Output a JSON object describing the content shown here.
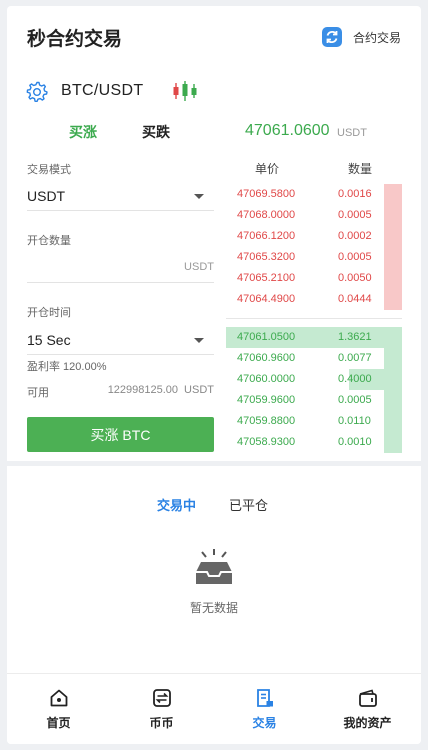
{
  "header": {
    "title": "秒合约交易",
    "contract_link_label": "合约交易",
    "contract_icon": "swap-icon"
  },
  "pair": {
    "settings_icon": "gear-icon",
    "name": "BTC/USDT",
    "chart_icon": "candlestick-icon"
  },
  "side_tabs": {
    "buy_label": "买涨",
    "sell_label": "买跌",
    "selected": "buy"
  },
  "last_price": {
    "value": "47061.0600",
    "unit": "USDT"
  },
  "form": {
    "mode_label": "交易模式",
    "mode_value": "USDT",
    "qty_label": "开仓数量",
    "qty_value": "",
    "qty_unit": "USDT",
    "time_label": "开仓时间",
    "time_value": "15 Sec",
    "profit_rate": "盈利率 120.00%",
    "available_label": "可用",
    "available_value": "122998125.00",
    "available_unit": "USDT",
    "submit_label": "买涨 BTC"
  },
  "orderbook": {
    "price_header": "单价",
    "qty_header": "数量",
    "asks": [
      {
        "price": "47069.5800",
        "qty": "0.0016",
        "depth": 0.1
      },
      {
        "price": "47068.0000",
        "qty": "0.0005",
        "depth": 0.1
      },
      {
        "price": "47066.1200",
        "qty": "0.0002",
        "depth": 0.1
      },
      {
        "price": "47065.3200",
        "qty": "0.0005",
        "depth": 0.1
      },
      {
        "price": "47065.2100",
        "qty": "0.0050",
        "depth": 0.1
      },
      {
        "price": "47064.4900",
        "qty": "0.0444",
        "depth": 0.1
      }
    ],
    "bids": [
      {
        "price": "47061.0500",
        "qty": "1.3621",
        "depth": 1.0
      },
      {
        "price": "47060.9600",
        "qty": "0.0077",
        "depth": 0.1
      },
      {
        "price": "47060.0000",
        "qty": "0.4000",
        "depth": 0.3
      },
      {
        "price": "47059.9600",
        "qty": "0.0005",
        "depth": 0.1
      },
      {
        "price": "47059.8800",
        "qty": "0.0110",
        "depth": 0.1
      },
      {
        "price": "47058.9300",
        "qty": "0.0010",
        "depth": 0.1
      }
    ]
  },
  "positions": {
    "tab_active": "交易中",
    "tab_closed": "已平仓",
    "empty_text": "暂无数据",
    "empty_icon": "empty-tray-icon"
  },
  "tabbar": {
    "items": [
      {
        "label": "首页",
        "icon": "home-icon",
        "active": false
      },
      {
        "label": "币币",
        "icon": "exchange-icon",
        "active": false
      },
      {
        "label": "交易",
        "icon": "trade-icon",
        "active": true
      },
      {
        "label": "我的资产",
        "icon": "wallet-icon",
        "active": false
      }
    ]
  },
  "colors": {
    "buy_green": "#4cb054",
    "sell_red": "#e04848",
    "accent_blue": "#2a82e4",
    "ask_bar": "#f8c8c8",
    "bid_bar": "#c5ead1"
  }
}
